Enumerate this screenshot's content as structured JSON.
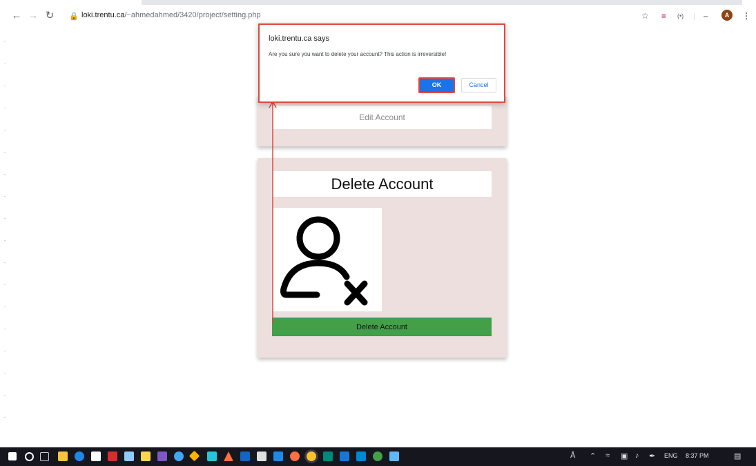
{
  "browser": {
    "url_host": "loki.trentu.ca",
    "url_path": "/~ahmedahmed/3420/project/setting.php",
    "icons": [
      "back-icon",
      "forward-icon",
      "reload-icon",
      "lock-icon",
      "star-icon",
      "extension-icon",
      "cast-icon",
      "key-icon",
      "menu-icon"
    ],
    "avatar_letter": "A"
  },
  "dialog": {
    "title": "loki.trentu.ca says",
    "message": "Are you sure you want to delete your account? This action is irreversible!",
    "ok_label": "OK",
    "cancel_label": "Cancel"
  },
  "edit_card": {
    "button_label": "Edit Account"
  },
  "delete_card": {
    "title": "Delete Account",
    "image_icon": "user-remove-icon",
    "button_label": "Delete Account",
    "button_color": "#43a047"
  },
  "taskbar": {
    "language": "ENG",
    "time": "8:37 PM"
  },
  "colors": {
    "card_bg": "#ecdfdd",
    "highlight": "#e0483e",
    "primary": "#1a73e8"
  }
}
